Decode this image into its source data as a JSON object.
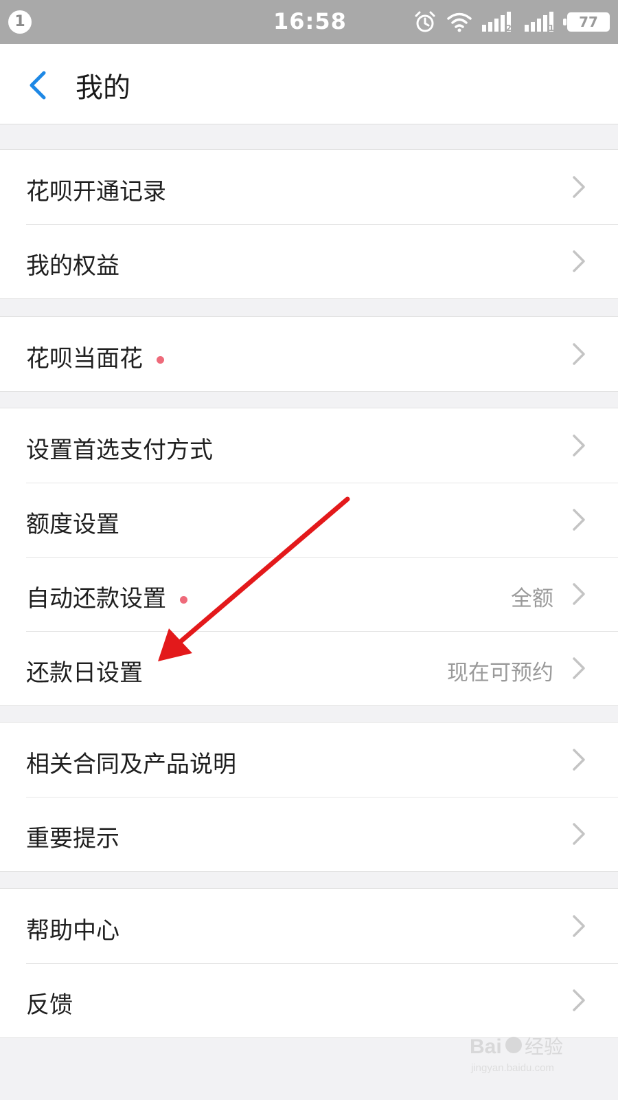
{
  "status_bar": {
    "badge": "1",
    "time": "16:58",
    "battery": "77",
    "sim1_label": "2",
    "sim2_label": "1"
  },
  "header": {
    "title": "我的",
    "back_icon": "chevron-left-icon"
  },
  "groups": [
    {
      "items": [
        {
          "label": "花呗开通记录",
          "value": "",
          "dot": false
        },
        {
          "label": "我的权益",
          "value": "",
          "dot": false
        }
      ]
    },
    {
      "items": [
        {
          "label": "花呗当面花",
          "value": "",
          "dot": true
        }
      ]
    },
    {
      "items": [
        {
          "label": "设置首选支付方式",
          "value": "",
          "dot": false
        },
        {
          "label": "额度设置",
          "value": "",
          "dot": false
        },
        {
          "label": "自动还款设置",
          "value": "全额",
          "dot": true
        },
        {
          "label": "还款日设置",
          "value": "现在可预约",
          "dot": false
        }
      ]
    },
    {
      "items": [
        {
          "label": "相关合同及产品说明",
          "value": "",
          "dot": false
        },
        {
          "label": "重要提示",
          "value": "",
          "dot": false
        }
      ]
    },
    {
      "items": [
        {
          "label": "帮助中心",
          "value": "",
          "dot": false
        },
        {
          "label": "反馈",
          "value": "",
          "dot": false
        }
      ]
    }
  ],
  "colors": {
    "accent": "#1e88e5",
    "badge_dot": "#ee6a7a",
    "annotation_arrow": "#e3191b",
    "background": "#f2f2f4"
  },
  "watermark": {
    "brand": "Baidu经验",
    "domain": "jingyan.baidu.com"
  }
}
